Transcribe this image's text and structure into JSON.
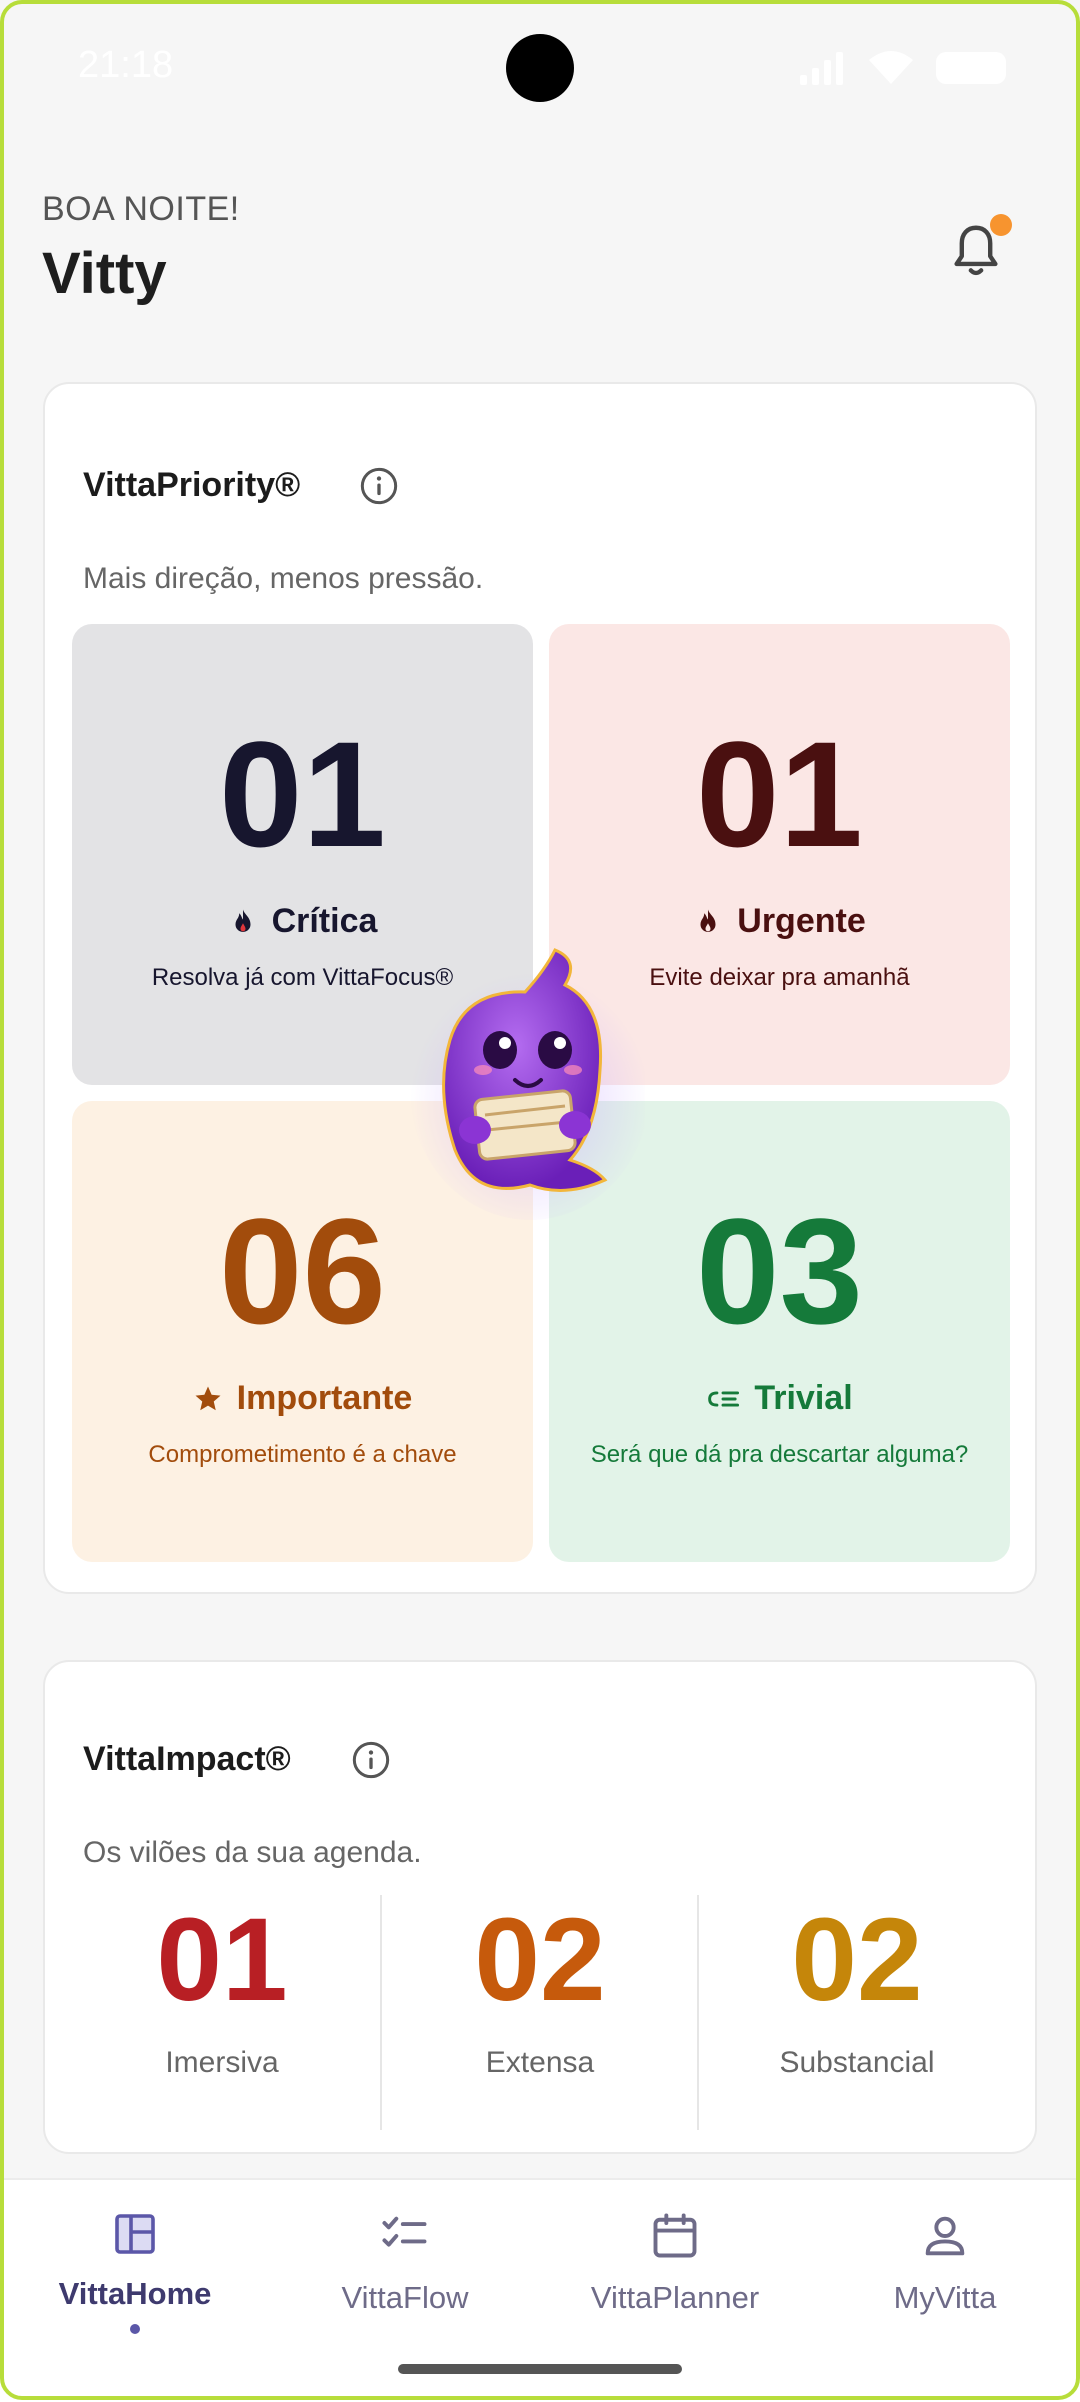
{
  "status_bar": {
    "time": "21:18"
  },
  "header": {
    "greeting": "BOA NOITE!",
    "user_name": "Vitty"
  },
  "priority": {
    "title": "VittaPriority®",
    "subtitle": "Mais direção, menos pressão.",
    "quadrants": [
      {
        "count": "01",
        "label": "Crítica",
        "description": "Resolva já com VittaFocus®",
        "icon": "flame-icon",
        "color": "#17162e",
        "bg": "#e3e3e5"
      },
      {
        "count": "01",
        "label": "Urgente",
        "description": "Evite deixar pra amanhã",
        "icon": "flame-icon",
        "color": "#4a1010",
        "bg": "#fbe7e5"
      },
      {
        "count": "06",
        "label": "Importante",
        "description": "Comprometimento é a chave",
        "icon": "star-icon",
        "color": "#a24c0c",
        "bg": "#fdf1e3"
      },
      {
        "count": "03",
        "label": "Trivial",
        "description": "Será que dá pra descartar alguma?",
        "icon": "list-icon",
        "color": "#157a3a",
        "bg": "#e2f3e8"
      }
    ]
  },
  "impact": {
    "title": "VittaImpact®",
    "subtitle": "Os vilões da sua agenda.",
    "items": [
      {
        "count": "01",
        "label": "Imersiva",
        "color": "#b81f24"
      },
      {
        "count": "02",
        "label": "Extensa",
        "color": "#c65a0c"
      },
      {
        "count": "02",
        "label": "Substancial",
        "color": "#c5860a"
      }
    ]
  },
  "nav": {
    "items": [
      {
        "label": "VittaHome",
        "icon": "dashboard-icon",
        "active": true
      },
      {
        "label": "VittaFlow",
        "icon": "checklist-icon",
        "active": false
      },
      {
        "label": "VittaPlanner",
        "icon": "calendar-icon",
        "active": false
      },
      {
        "label": "MyVitta",
        "icon": "person-icon",
        "active": false
      }
    ]
  }
}
